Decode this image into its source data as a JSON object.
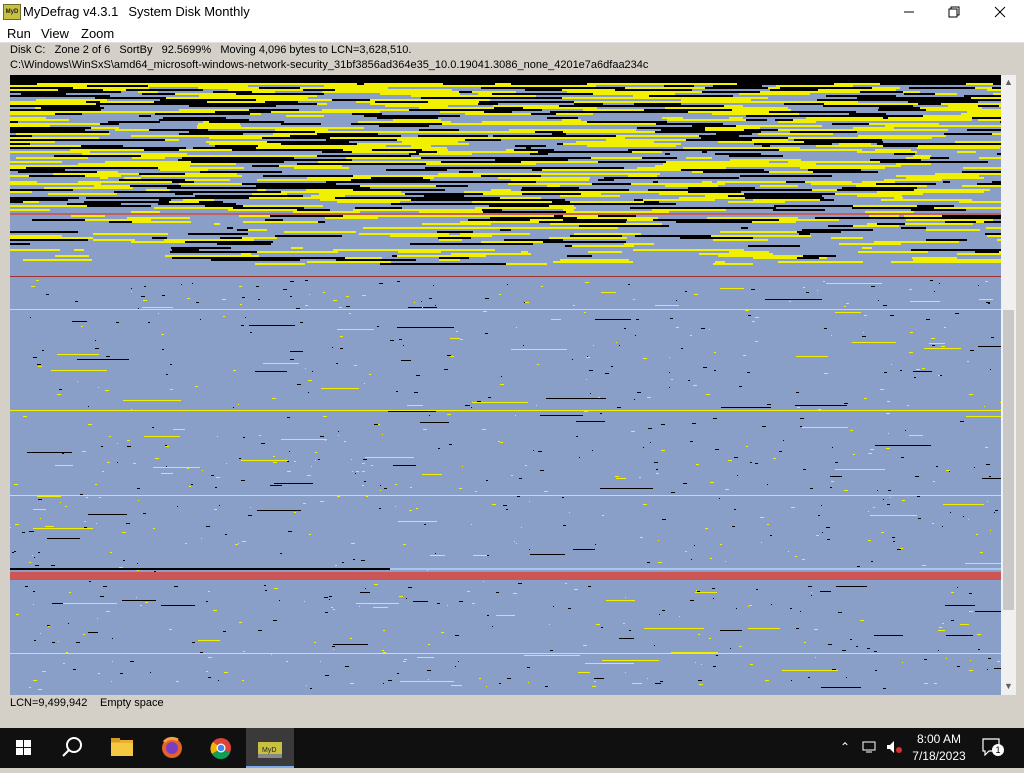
{
  "window": {
    "app_name": "MyDefrag v4.3.1",
    "script_name": "System Disk Monthly",
    "icon_label": "MyD"
  },
  "menu": {
    "items": [
      "Run",
      "View",
      "Zoom"
    ]
  },
  "status": {
    "disk_line": "Disk C:   Zone 2 of 6   SortBy   92.5699%   Moving 4,096 bytes to LCN=3,628,510.",
    "path": "C:\\Windows\\WinSxS\\amd64_microsoft-windows-network-security_31bf3856ad364e35_10.0.19041.3086_none_4201e7a6dfaa234c"
  },
  "bottom_status": {
    "lcn": "LCN=9,499,942",
    "description": "Empty space"
  },
  "colors": {
    "empty": "#8a9fc8",
    "unmovable": "#000000",
    "fragmented": "#f0f000",
    "mft": "#cc5555",
    "highlight": "#a8c8f0"
  },
  "taskbar": {
    "icons": [
      "windows-start-icon",
      "search-icon",
      "file-explorer-icon",
      "firefox-icon",
      "chrome-icon",
      "mydefrag-icon"
    ],
    "time": "8:00 AM",
    "date": "7/18/2023",
    "notification_count": "1"
  }
}
